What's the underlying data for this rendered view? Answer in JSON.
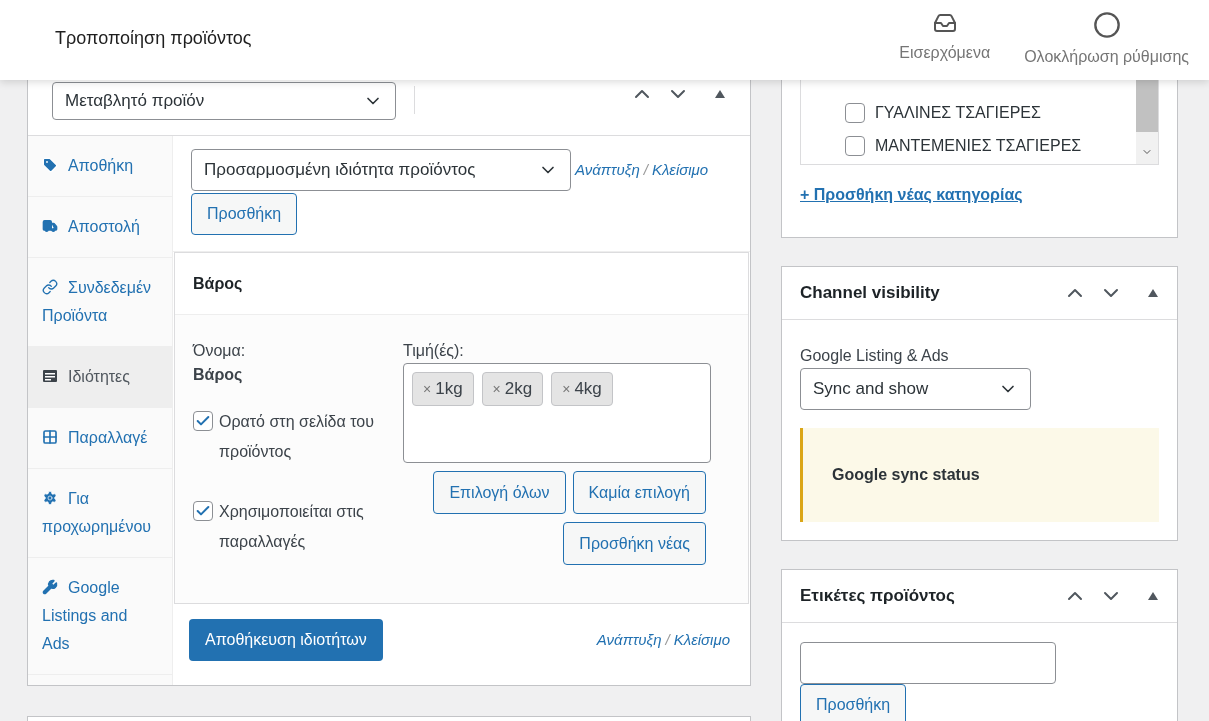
{
  "header": {
    "title": "Τροποποίηση προϊόντος",
    "actions": [
      {
        "label": "Εισερχόμενα",
        "kind": "inbox"
      },
      {
        "label": "Ολοκλήρωση ρύθμισης",
        "kind": "setup"
      }
    ]
  },
  "product_data": {
    "product_type": "Μεταβλητό προϊόν",
    "tabs": [
      {
        "label": "Αποθήκη",
        "kind": "inventory",
        "selected": false
      },
      {
        "label": "Αποστολή",
        "kind": "shipping",
        "selected": false
      },
      {
        "label": "Συνδεδεμέν Προϊόντα",
        "kind": "linked",
        "selected": false
      },
      {
        "label": "Ιδιότητες",
        "kind": "attributes",
        "selected": true
      },
      {
        "label": "Παραλλαγέ",
        "kind": "variations",
        "selected": false
      },
      {
        "label": "Για προχωρημένου",
        "kind": "advanced",
        "selected": false
      },
      {
        "label": "Google Listings and Ads",
        "kind": "integration",
        "selected": false
      }
    ],
    "attribute_select": "Προσαρμοσμένη ιδιότητα προϊόντος",
    "expand_link": "Ανάπτυξη",
    "separator": "/",
    "close_link": "Κλείσιμο",
    "add_button": "Προσθήκη",
    "attribute": {
      "title": "Βάρος",
      "name_label": "Όνομα:",
      "name": "Βάρος",
      "values_label": "Τιμή(ές):",
      "remove_mark": "×",
      "values": [
        "1kg",
        "2kg",
        "4kg"
      ],
      "options": [
        {
          "label": "Ορατό στη σελίδα του προϊόντος",
          "checked": true
        },
        {
          "label": "Χρησιμοποιείται στις παραλλαγές",
          "checked": true
        }
      ],
      "buttons": [
        "Επιλογή όλων",
        "Καμία επιλογή",
        "Προσθήκη νέας"
      ]
    },
    "save_button": "Αποθήκευση ιδιοτήτων",
    "footer_expand_link": "Ανάπτυξη",
    "footer_separator": "/",
    "footer_close_link": "Κλείσιμο"
  },
  "categories": {
    "items": [
      {
        "label": "ΓΥΑΛΙΝΕΣ ΤΣΑΓΙΕΡΕΣ",
        "checked": false
      },
      {
        "label": "ΜΑΝΤΕΜΕΝΙΕΣ ΤΣΑΓΙΕΡΕΣ",
        "checked": false
      }
    ],
    "add_link": "+ Προσθήκη νέας κατηγορίας"
  },
  "channel_visibility": {
    "title": "Channel visibility",
    "label": "Google Listing & Ads",
    "value": "Sync and show",
    "notice": "Google sync status"
  },
  "tags": {
    "title": "Ετικέτες προϊόντος",
    "add_button": "Προσθήκη"
  }
}
